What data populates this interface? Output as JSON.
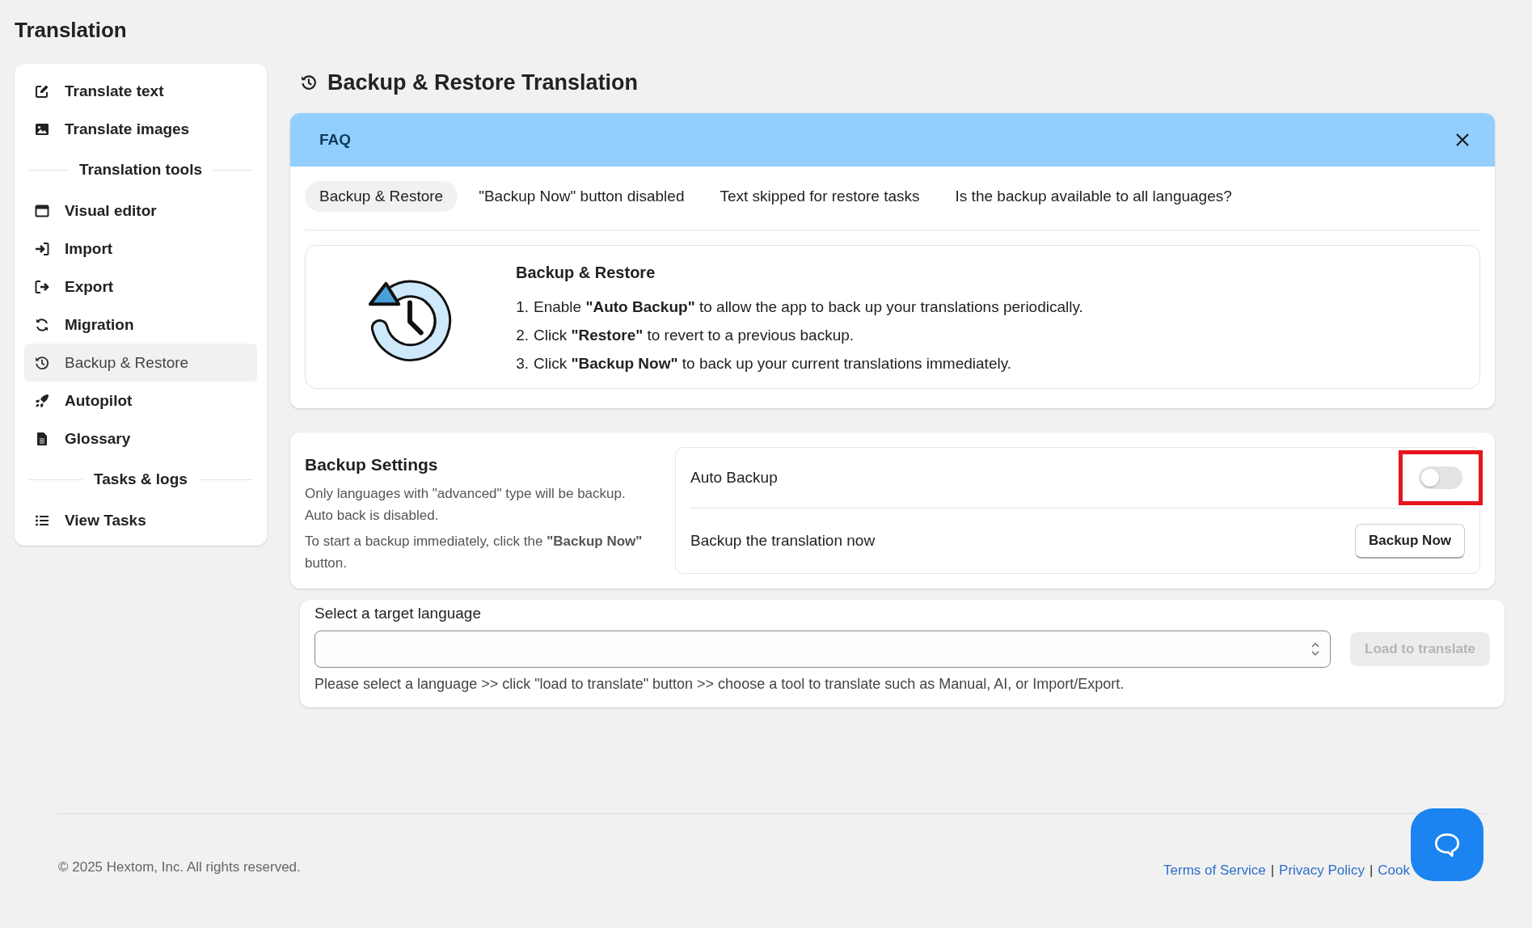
{
  "page_title": "Translation",
  "sidebar": {
    "items": [
      {
        "kind": "link",
        "label": "Translate text",
        "selected": false
      },
      {
        "kind": "link",
        "label": "Translate images",
        "selected": false
      },
      {
        "kind": "heading",
        "label": "Translation tools"
      },
      {
        "kind": "link",
        "label": "Visual editor",
        "selected": false
      },
      {
        "kind": "link",
        "label": "Import",
        "selected": false
      },
      {
        "kind": "link",
        "label": "Export",
        "selected": false
      },
      {
        "kind": "link",
        "label": "Migration",
        "selected": false
      },
      {
        "kind": "link",
        "label": "Backup & Restore",
        "selected": true
      },
      {
        "kind": "link",
        "label": "Autopilot",
        "selected": false
      },
      {
        "kind": "link",
        "label": "Glossary",
        "selected": false
      },
      {
        "kind": "heading",
        "label": "Tasks & logs"
      },
      {
        "kind": "link",
        "label": "View Tasks",
        "selected": false
      }
    ]
  },
  "heading": "Backup & Restore Translation",
  "faq": {
    "title": "FAQ",
    "tabs": [
      {
        "label": "Backup & Restore",
        "selected": true
      },
      {
        "label": "\"Backup Now\" button disabled",
        "selected": false
      },
      {
        "label": "Text skipped for restore tasks",
        "selected": false
      },
      {
        "label": "Is the backup available to all languages?",
        "selected": false
      }
    ],
    "content": {
      "heading": "Backup & Restore",
      "steps": [
        {
          "number": "1.",
          "text": "Enable **\"Auto Backup\"** to allow the app to back up your translations periodically."
        },
        {
          "number": "2.",
          "text": "Click **\"Restore\"** to revert to a previous backup."
        },
        {
          "number": "3.",
          "text": "Click **\"Backup Now\"** to back up your current translations immediately."
        }
      ]
    }
  },
  "settings": {
    "title": "Backup Settings",
    "description": [
      "Only languages with \"advanced\" type will be backup.",
      "Auto back is disabled."
    ],
    "hint": "To start a backup immediately, click the **\"Backup Now\"** button.",
    "rows": [
      {
        "kind": "toggle",
        "label": "Auto Backup",
        "on": false
      },
      {
        "kind": "button",
        "label": "Backup the translation now",
        "button": "Backup Now"
      }
    ]
  },
  "language": {
    "label": "Select a target language",
    "button": {
      "label": "Load to translate",
      "disabled": true
    },
    "hint": "Please select a language >> click \"load to translate\" button >> choose a tool to translate such as Manual, AI, or Import/Export."
  },
  "footer": {
    "copyright": "© 2025 Hextom, Inc. All rights reserved.",
    "links": [
      {
        "kind": "link",
        "text": "Terms of Service"
      },
      {
        "kind": "separator",
        "text": "|"
      },
      {
        "kind": "link",
        "text": "Privacy Policy"
      },
      {
        "kind": "separator",
        "text": "|"
      },
      {
        "kind": "link",
        "text": "Cook"
      }
    ]
  }
}
